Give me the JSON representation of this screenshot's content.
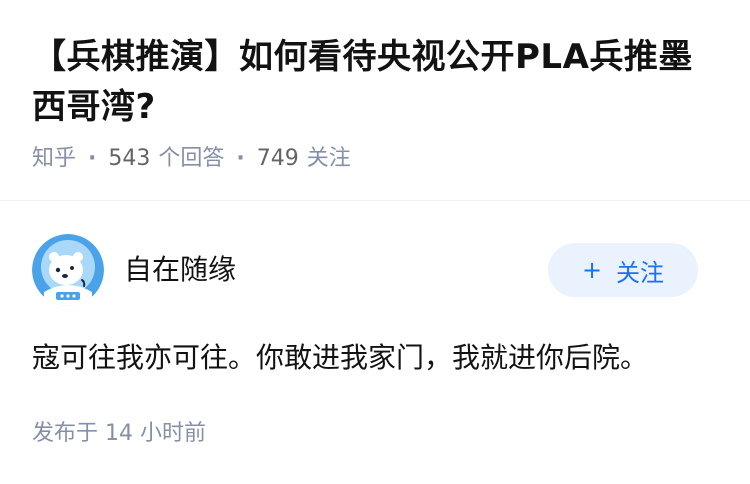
{
  "question": {
    "title": "【兵棋推演】如何看待央视公开PLA兵推墨西哥湾?",
    "source": "知乎",
    "answer_count": "543",
    "answer_label": "个回答",
    "follower_count": "749",
    "follower_label": "关注"
  },
  "answer": {
    "author_name": "自在随缘",
    "avatar_icon": "polar-bear-astronaut-avatar",
    "follow_label": "关注",
    "content": "寇可往我亦可往。你敢进我家门，我就进你后院。",
    "time_label": "发布于",
    "time_value": "14 小时前"
  },
  "colors": {
    "accent": "#1772f6",
    "follow_bg": "#eaf2fd",
    "meta_text": "#8590a6",
    "avatar_bg": "#4aa3e8"
  }
}
